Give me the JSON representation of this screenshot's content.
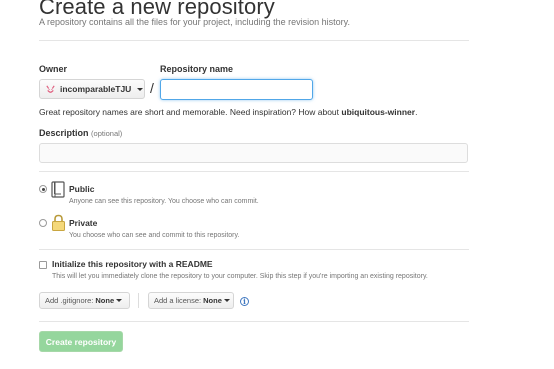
{
  "header": {
    "title": "Create a new repository",
    "subtitle": "A repository contains all the files for your project, including the revision history."
  },
  "owner": {
    "label": "Owner",
    "value": "incomparableTJU"
  },
  "repository": {
    "label": "Repository name",
    "slash": "/",
    "value": "",
    "hint_prefix": "Great repository names are short and memorable. Need inspiration? How about ",
    "hint_suggestion": "ubiquitous-winner",
    "hint_suffix": "."
  },
  "description": {
    "label": "Description",
    "optional": "(optional)",
    "value": ""
  },
  "visibility": {
    "public": {
      "title": "Public",
      "note": "Anyone can see this repository. You choose who can commit.",
      "selected": true
    },
    "private": {
      "title": "Private",
      "note": "You choose who can see and commit to this repository.",
      "selected": false
    }
  },
  "readme": {
    "title": "Initialize this repository with a README",
    "note": "This will let you immediately clone the repository to your computer. Skip this step if you're importing an existing repository.",
    "checked": false
  },
  "gitignore": {
    "prefix": "Add .gitignore:",
    "value": "None"
  },
  "license": {
    "prefix": "Add a license:",
    "value": "None"
  },
  "info_icon": "i",
  "submit": {
    "label": "Create repository"
  },
  "colors": {
    "accent_blue": "#51a7e8",
    "link_blue": "#4078c0",
    "create_green": "#95d69d"
  },
  "icons": {
    "owner_avatar": "octocat-avatar-icon",
    "public": "repo-book-icon",
    "private": "lock-icon",
    "info": "info-icon"
  }
}
